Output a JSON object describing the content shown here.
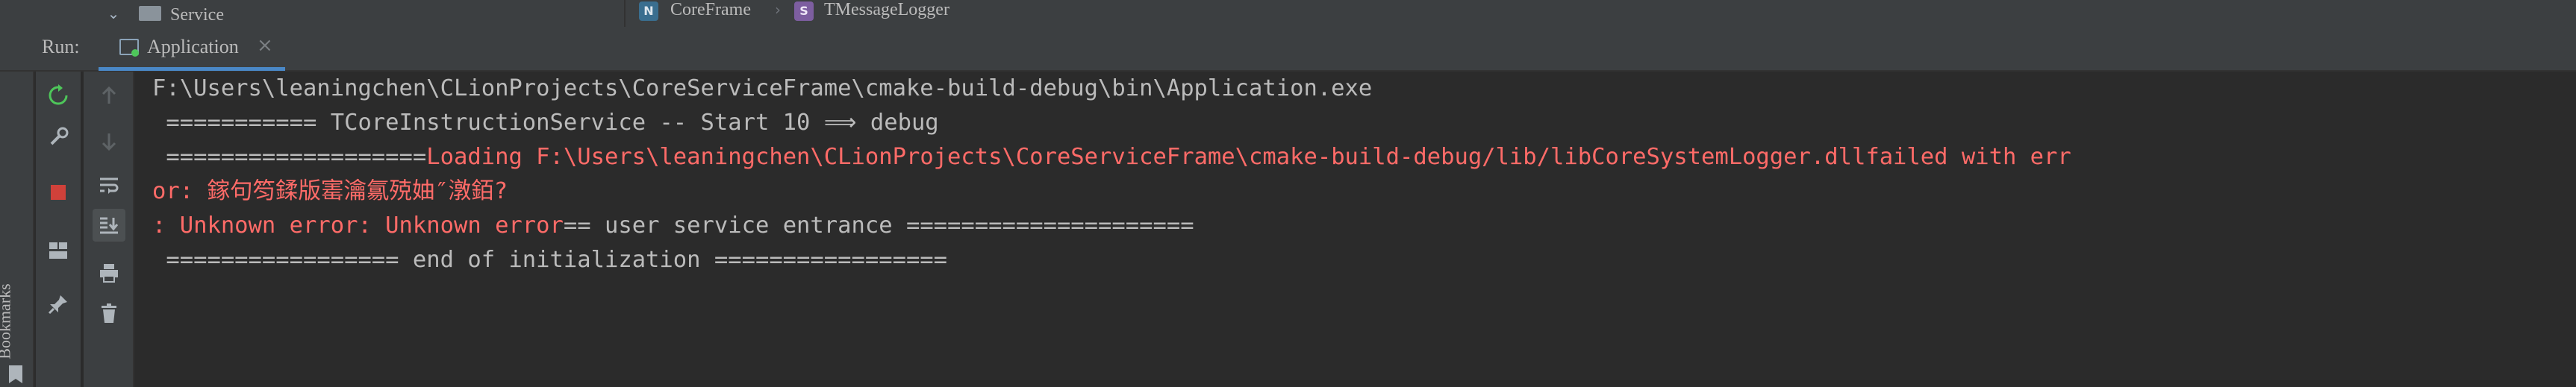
{
  "project_tree": {
    "expand_icon": "chevron-down-icon",
    "folder_icon": "folder-icon",
    "item_label": "Service"
  },
  "breadcrumb": {
    "item1": {
      "icon_letter": "N",
      "label": "CoreFrame"
    },
    "separator": "›",
    "item2": {
      "icon_letter": "S",
      "label": "TMessageLogger"
    }
  },
  "run_window": {
    "label": "Run:",
    "tab": {
      "label": "Application",
      "close": "×",
      "icon": "application-icon"
    }
  },
  "sidebar": {
    "bookmarks_label": "Bookmarks"
  },
  "toolbar": {
    "rerun": "rerun-icon",
    "settings": "wrench-icon",
    "stop": "stop-icon",
    "layout": "layout-icon",
    "pin": "pin-icon",
    "up": "arrow-up-icon",
    "down": "arrow-down-icon",
    "soft_wrap": "soft-wrap-icon",
    "scroll_to_end": "scroll-to-end-icon",
    "print": "print-icon",
    "clear": "trash-icon"
  },
  "console": {
    "lines": [
      {
        "segments": [
          {
            "text": "F:\\Users\\leaningchen\\CLionProjects\\CoreServiceFrame\\cmake-build-debug\\bin\\Application.exe",
            "kind": "std"
          }
        ]
      },
      {
        "segments": [
          {
            "text": " =========== TCoreInstructionService -- Start 10 ⟹ debug",
            "kind": "std"
          }
        ]
      },
      {
        "segments": [
          {
            "text": " ===================",
            "kind": "std"
          },
          {
            "text": "Loading F:\\Users\\leaningchen\\CLionProjects\\CoreServiceFrame\\cmake-build-debug/lib/libCoreSystemLogger.dllfailed with err",
            "kind": "err"
          }
        ]
      },
      {
        "segments": [
          {
            "text": "or: 鎵句笉鍒版寚瀹氱殑妯″潡銆?",
            "kind": "err"
          }
        ]
      },
      {
        "segments": [
          {
            "text": ": Unknown error: Unknown error",
            "kind": "err"
          },
          {
            "text": "== user service entrance =====================",
            "kind": "std"
          }
        ]
      },
      {
        "segments": [
          {
            "text": " ================= end of initialization =================",
            "kind": "std"
          }
        ]
      }
    ]
  },
  "colors": {
    "background": "#2b2b2b",
    "panel": "#3c3f41",
    "std_text": "#bbbbbb",
    "error_text": "#ff6b68",
    "tab_accent": "#4a88c7",
    "stop_red": "#d0413a",
    "rerun_green": "#4ec65a"
  }
}
